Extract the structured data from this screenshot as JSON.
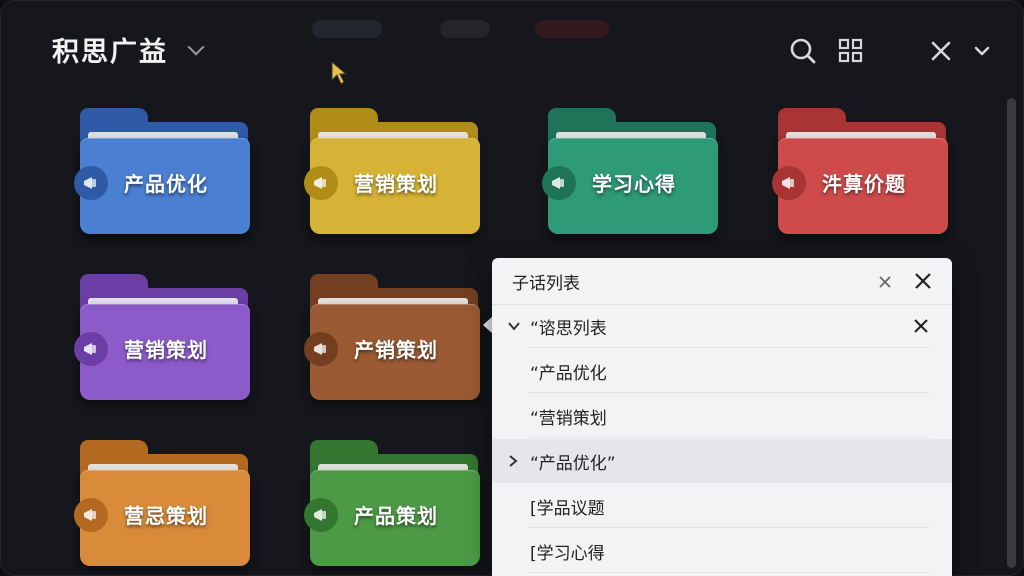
{
  "header": {
    "title": "积思广益"
  },
  "folders": [
    {
      "label": "产品优化",
      "color": "#4a7fd1",
      "dark": "#2e5aa8",
      "badge_icon": "megaphone-icon"
    },
    {
      "label": "营销策划",
      "color": "#d6b236",
      "dark": "#b08d16",
      "badge_icon": "megaphone-icon"
    },
    {
      "label": "学习心得",
      "color": "#2f9a78",
      "dark": "#1e7358",
      "badge_icon": "megaphone-icon"
    },
    {
      "label": "汼萛价题",
      "color": "#cf4b4b",
      "dark": "#a83434",
      "badge_icon": "megaphone-icon"
    },
    {
      "label": "营销策划",
      "color": "#8d5ac9",
      "dark": "#6a3ea5",
      "badge_icon": "megaphone-icon"
    },
    {
      "label": "产销策划",
      "color": "#9a5a33",
      "dark": "#733f20",
      "badge_icon": "megaphone-icon"
    },
    {
      "label": "营忌策划",
      "color": "#d98b3a",
      "dark": "#b36a20",
      "badge_icon": "megaphone-icon"
    },
    {
      "label": "产品策划",
      "color": "#4c9a45",
      "dark": "#33762f",
      "badge_icon": "megaphone-icon"
    }
  ],
  "popup": {
    "title": "子话列表",
    "rows": [
      {
        "text": "“谘思列表",
        "chevron": "down"
      },
      {
        "text": "“产品优化",
        "chevron": ""
      },
      {
        "text": "“营销策划",
        "chevron": ""
      },
      {
        "text": "“产品优化”",
        "chevron": "right"
      },
      {
        "text": "[学品议题",
        "chevron": ""
      },
      {
        "text": "[学习心得",
        "chevron": ""
      }
    ]
  }
}
